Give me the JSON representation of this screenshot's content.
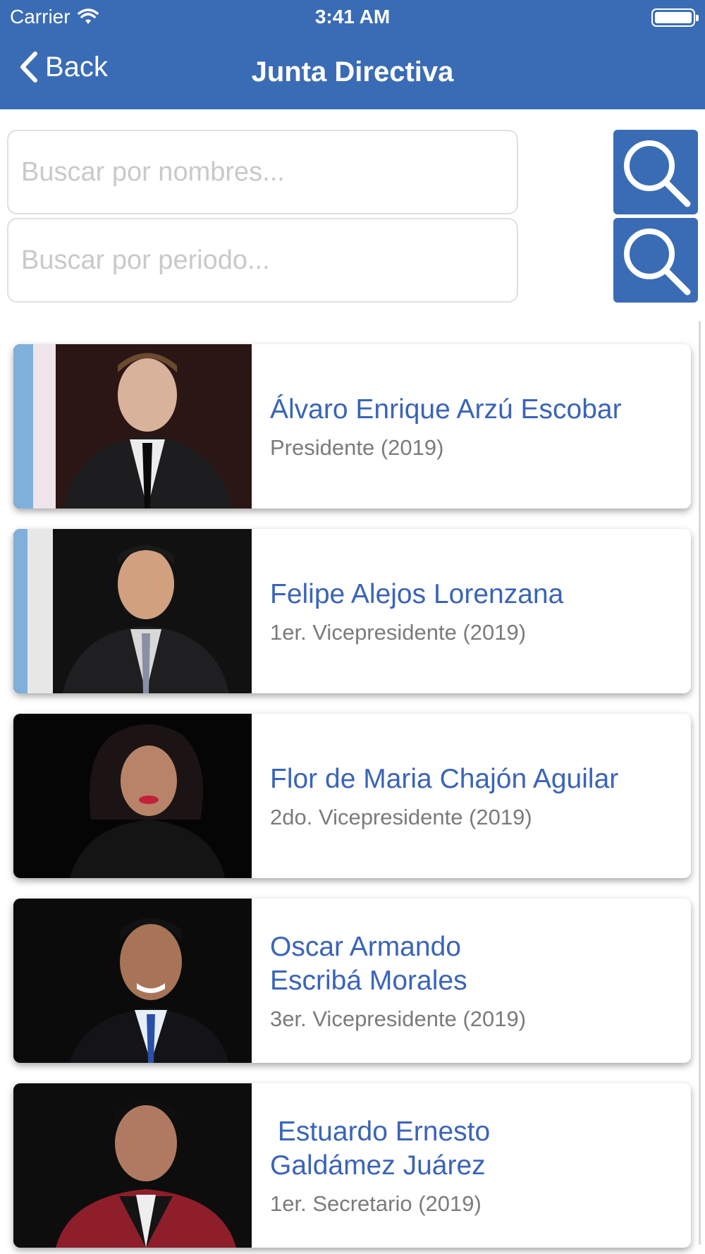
{
  "status_bar": {
    "carrier": "Carrier",
    "time": "3:41 AM"
  },
  "nav": {
    "back_label": "Back",
    "title": "Junta Directiva"
  },
  "search": {
    "names_placeholder": "Buscar por nombres...",
    "period_placeholder": "Buscar por periodo..."
  },
  "colors": {
    "accent": "#3a6cb5",
    "name": "#3a64b8",
    "role": "#7b7b7b"
  },
  "members": [
    {
      "name_line1": "Álvaro Enrique Arzú Escobar",
      "name_line2": "",
      "role": "Presidente (2019)"
    },
    {
      "name_line1": "Felipe Alejos Lorenzana",
      "name_line2": "",
      "role": "1er. Vicepresidente (2019)"
    },
    {
      "name_line1": "Flor de Maria Chajón Aguilar",
      "name_line2": "",
      "role": "2do. Vicepresidente (2019)"
    },
    {
      "name_line1": "Oscar Armando",
      "name_line2": "Escribá Morales",
      "role": "3er. Vicepresidente (2019)"
    },
    {
      "name_line1": " Estuardo Ernesto",
      "name_line2": "Galdámez Juárez",
      "role": "1er. Secretario (2019)"
    }
  ]
}
